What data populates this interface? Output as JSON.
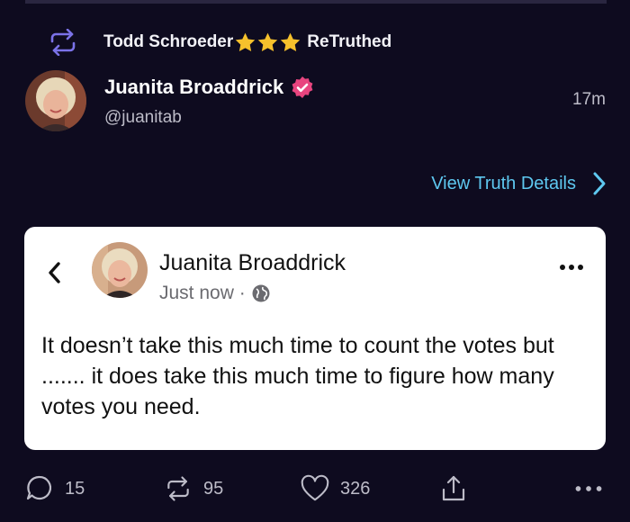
{
  "retruth": {
    "user": "Todd Schroeder",
    "label": "ReTruthed",
    "star_count": 3
  },
  "post": {
    "author_name": "Juanita Broaddrick",
    "handle": "@juanitab",
    "time": "17m",
    "details_link": "View Truth Details"
  },
  "embedded": {
    "name": "Juanita Broaddrick",
    "meta": "Just now ·",
    "text": "It doesn’t take this much time to count the votes but ....... it does take this much time to figure how many votes you need."
  },
  "actions": {
    "replies": "15",
    "retruths": "95",
    "likes": "326"
  },
  "colors": {
    "background": "#0e0b1f",
    "link": "#5ec8f0",
    "star": "#f6c12c",
    "verified": "#e8457f",
    "retruth_icon": "#7b72e8"
  },
  "icons": [
    "retruth-icon",
    "star-icon",
    "verified-badge-icon",
    "chevron-right-icon",
    "back-arrow-icon",
    "globe-icon",
    "more-icon",
    "reply-icon",
    "heart-icon",
    "share-icon"
  ]
}
